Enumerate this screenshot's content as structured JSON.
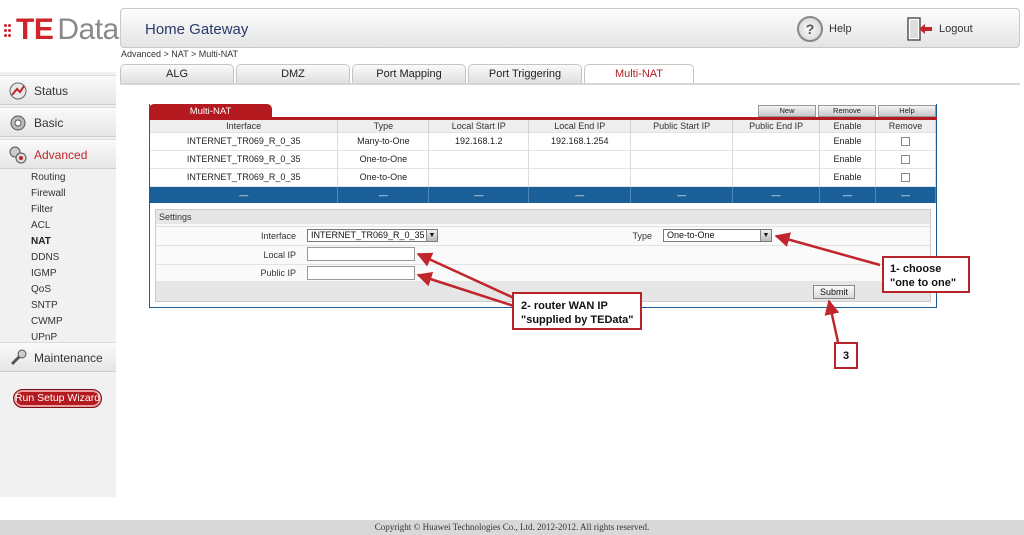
{
  "logo": {
    "brand_red": "TE",
    "brand_gray": "Data",
    "colors": {
      "red": "#d0232a",
      "gray": "#8a8a8a"
    }
  },
  "header": {
    "title": "Home Gateway",
    "help": "Help",
    "help_icon": "help-icon",
    "logout": "Logout",
    "logout_icon": "logout-icon"
  },
  "breadcrumb": "Advanced > NAT > Multi-NAT",
  "tabs": [
    "ALG",
    "DMZ",
    "Port Mapping",
    "Port Triggering",
    "Multi-NAT"
  ],
  "active_tab": "Multi-NAT",
  "sidebar": {
    "sections": [
      {
        "label": "Status",
        "icon": "status-icon"
      },
      {
        "label": "Basic",
        "icon": "basic-icon"
      },
      {
        "label": "Advanced",
        "icon": "advanced-icon"
      }
    ],
    "advanced_items": [
      "Routing",
      "Firewall",
      "Filter",
      "ACL",
      "NAT",
      "DDNS",
      "IGMP",
      "QoS",
      "SNTP",
      "CWMP",
      "UPnP"
    ],
    "active_item": "NAT",
    "maintenance": {
      "label": "Maintenance",
      "icon": "maintenance-icon"
    },
    "wizard": "Run Setup Wizard"
  },
  "panel": {
    "label": "Multi-NAT",
    "buttons": {
      "new": "New",
      "remove": "Remove",
      "help": "Help"
    },
    "columns": [
      "Interface",
      "Type",
      "Local Start IP",
      "Local End IP",
      "Public Start IP",
      "Public End IP",
      "Enable",
      "Remove"
    ],
    "rows": [
      {
        "interface": "INTERNET_TR069_R_0_35",
        "type": "Many-to-One",
        "local_start": "192.168.1.2",
        "local_end": "192.168.1.254",
        "public_start": "",
        "public_end": "",
        "enable": "Enable"
      },
      {
        "interface": "INTERNET_TR069_R_0_35",
        "type": "One-to-One",
        "local_start": "",
        "local_end": "",
        "public_start": "",
        "public_end": "",
        "enable": "Enable"
      },
      {
        "interface": "INTERNET_TR069_R_0_35",
        "type": "One-to-One",
        "local_start": "",
        "local_end": "",
        "public_start": "",
        "public_end": "",
        "enable": "Enable"
      }
    ],
    "placeholder_row": "—"
  },
  "settings": {
    "title": "Settings",
    "interface_label": "Interface",
    "interface_value": "INTERNET_TR069_R_0_35",
    "type_label": "Type",
    "type_value": "One-to-One",
    "local_ip_label": "Local IP",
    "public_ip_label": "Public IP",
    "submit": "Submit"
  },
  "annotations": {
    "one": {
      "line1": "1- choose",
      "line2": "\"one to one\""
    },
    "two": {
      "line1": "2- router WAN IP",
      "line2": "\"supplied by TEData\""
    },
    "three": "3",
    "color": "#c0262b"
  },
  "footer": "Copyright © Huawei Technologies Co., Ltd. 2012-2012. All rights reserved."
}
